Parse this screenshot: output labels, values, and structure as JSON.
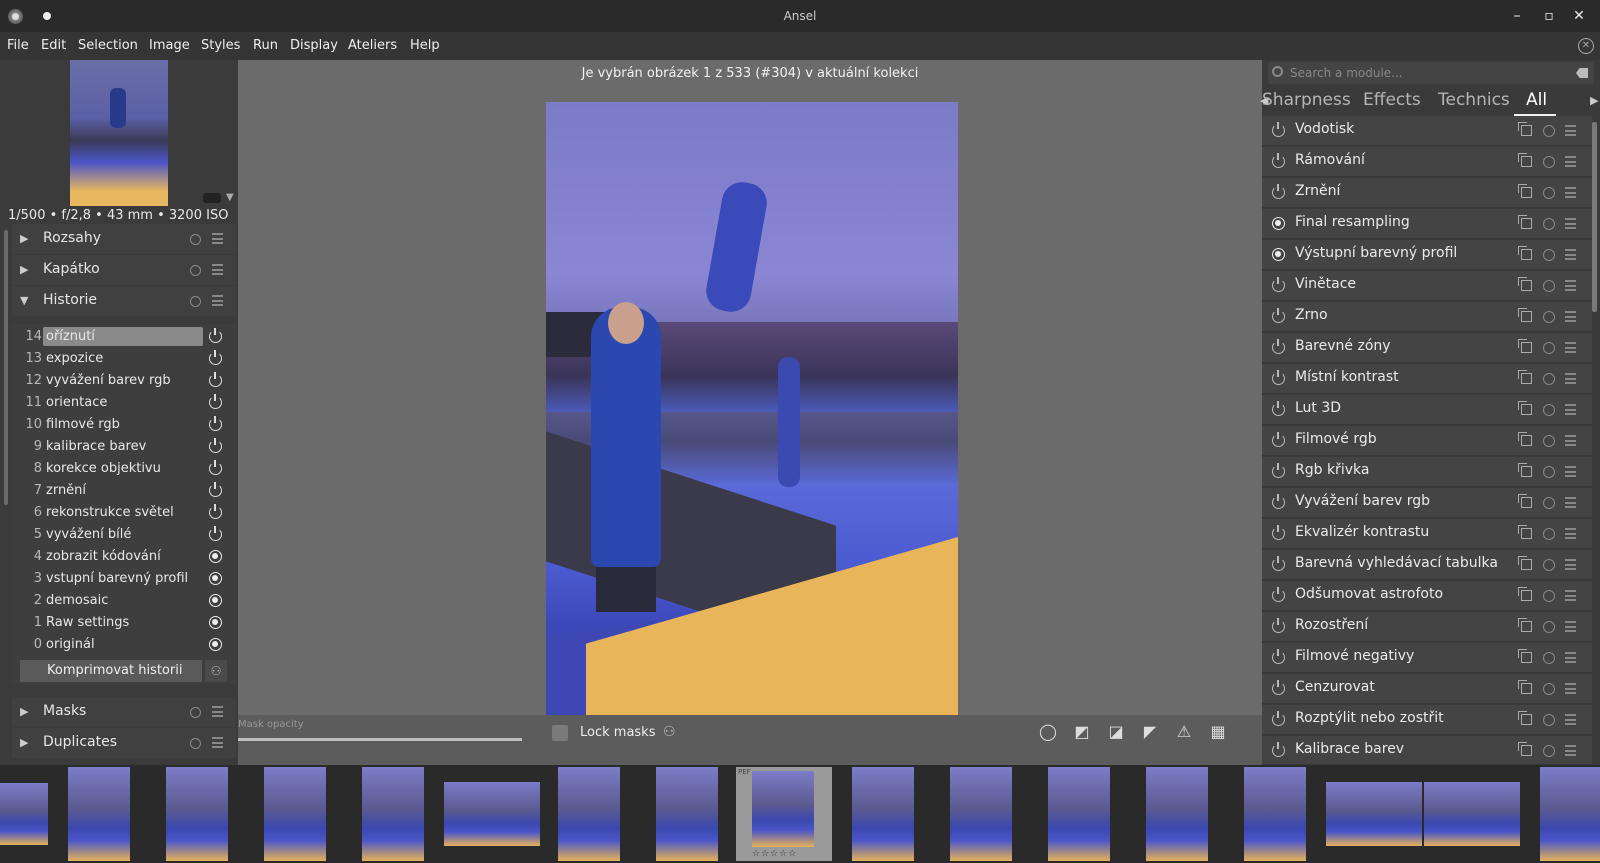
{
  "window": {
    "title": "Ansel",
    "minimize": "–",
    "maximize": "▫",
    "close": "✕"
  },
  "menu": [
    "File",
    "Edit",
    "Selection",
    "Image",
    "Styles",
    "Run",
    "Display",
    "Ateliers",
    "Help"
  ],
  "left": {
    "exif": "1/500 • f/2,8 • 43 mm • 3200 ISO",
    "sections": {
      "rozsahy": "Rozsahy",
      "kapatko": "Kapátko",
      "historie": "Historie",
      "masks": "Masks",
      "duplicates": "Duplicates"
    },
    "history": [
      {
        "num": "14",
        "name": "oříznutí",
        "state": "power",
        "selected": true
      },
      {
        "num": "13",
        "name": "expozice",
        "state": "power"
      },
      {
        "num": "12",
        "name": "vyvážení barev rgb",
        "state": "power"
      },
      {
        "num": "11",
        "name": "orientace",
        "state": "power"
      },
      {
        "num": "10",
        "name": "filmové rgb",
        "state": "power"
      },
      {
        "num": "9",
        "name": "kalibrace barev",
        "state": "power"
      },
      {
        "num": "8",
        "name": "korekce objektivu",
        "state": "power"
      },
      {
        "num": "7",
        "name": "zrnění",
        "state": "power"
      },
      {
        "num": "6",
        "name": "rekonstrukce světel",
        "state": "power"
      },
      {
        "num": "5",
        "name": "vyvážení bílé",
        "state": "power"
      },
      {
        "num": "4",
        "name": "zobrazit kódování",
        "state": "on"
      },
      {
        "num": "3",
        "name": "vstupní barevný profil",
        "state": "on"
      },
      {
        "num": "2",
        "name": "demosaic",
        "state": "on"
      },
      {
        "num": "1",
        "name": "Raw settings",
        "state": "on"
      },
      {
        "num": "0",
        "name": "originál",
        "state": "on"
      }
    ],
    "compress_label": "Komprimovat historii"
  },
  "center": {
    "info": "Je vybrán obrázek 1 z 533 (#304) v aktuální kolekci",
    "mask_opacity_label": "Mask opacity",
    "lock_masks_label": "Lock masks"
  },
  "right": {
    "search_placeholder": "Search a module...",
    "tabs": [
      "Sharpness",
      "Effects",
      "Technics",
      "All"
    ],
    "active_tab": "All",
    "modules": [
      {
        "name": "Vodotisk",
        "state": "power"
      },
      {
        "name": "Rámování",
        "state": "power"
      },
      {
        "name": "Zrnění",
        "state": "power"
      },
      {
        "name": "Final resampling",
        "state": "on"
      },
      {
        "name": "Výstupní barevný profil",
        "state": "on"
      },
      {
        "name": "Vinětace",
        "state": "power"
      },
      {
        "name": "Zrno",
        "state": "power"
      },
      {
        "name": "Barevné zóny",
        "state": "power"
      },
      {
        "name": "Místní kontrast",
        "state": "power"
      },
      {
        "name": "Lut 3D",
        "state": "power"
      },
      {
        "name": "Filmové rgb",
        "state": "power"
      },
      {
        "name": "Rgb křivka",
        "state": "power"
      },
      {
        "name": "Vyvážení barev rgb",
        "state": "power"
      },
      {
        "name": "Ekvalizér kontrastu",
        "state": "power"
      },
      {
        "name": "Barevná vyhledávací tabulka",
        "state": "power"
      },
      {
        "name": "Odšumovat astrofoto",
        "state": "power"
      },
      {
        "name": "Rozostření",
        "state": "power"
      },
      {
        "name": "Filmové negativy",
        "state": "power"
      },
      {
        "name": "Cenzurovat",
        "state": "power"
      },
      {
        "name": "Rozptýlit nebo zostřit",
        "state": "power"
      },
      {
        "name": "Kalibrace barev",
        "state": "power"
      }
    ]
  },
  "filmstrip": {
    "selected_label": "PEF",
    "selected_stars": "☆☆☆☆☆"
  }
}
